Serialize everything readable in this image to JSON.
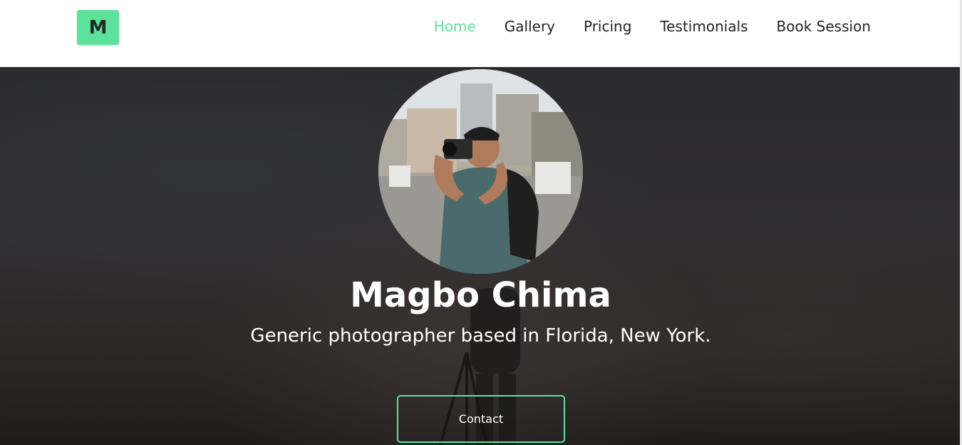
{
  "logo": {
    "letter": "M",
    "color": "#5ce29a"
  },
  "nav": {
    "items": [
      {
        "label": "Home",
        "active": true
      },
      {
        "label": "Gallery",
        "active": false
      },
      {
        "label": "Pricing",
        "active": false
      },
      {
        "label": "Testimonials",
        "active": false
      },
      {
        "label": "Book Session",
        "active": false
      }
    ],
    "active_color": "#5ce29a"
  },
  "hero": {
    "name": "Magbo Chima",
    "tagline": "Generic photographer based in Florida, New York.",
    "contact_label": "Contact",
    "accent": "#5ce29a"
  }
}
